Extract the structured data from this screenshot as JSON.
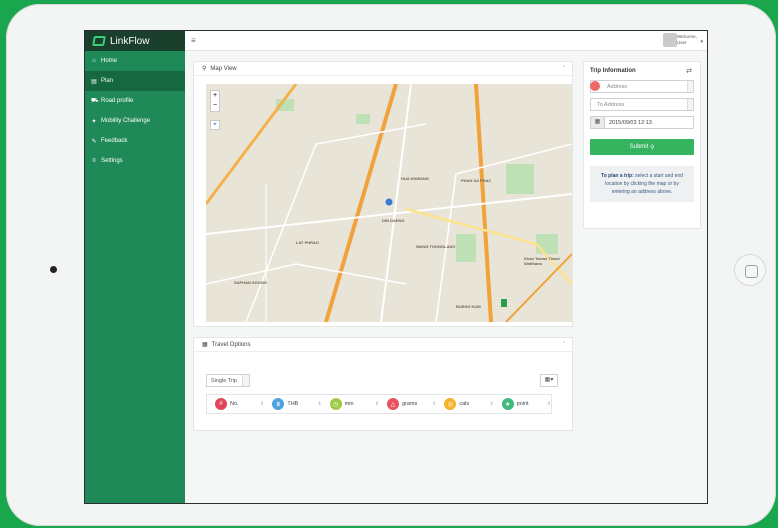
{
  "app": {
    "brand": "LinkFlow"
  },
  "sidebar": {
    "items": [
      {
        "label": "Home",
        "icon": "home-icon",
        "glyph": "⌂"
      },
      {
        "label": "Plan",
        "icon": "document-icon",
        "glyph": "▤"
      },
      {
        "label": "Road profile",
        "icon": "car-icon",
        "glyph": "⛟"
      },
      {
        "label": "Mobility Challenge",
        "icon": "trophy-icon",
        "glyph": "✦"
      },
      {
        "label": "Feedback",
        "icon": "chat-icon",
        "glyph": "✎"
      },
      {
        "label": "Settings",
        "icon": "list-icon",
        "glyph": "≡"
      }
    ]
  },
  "topbar": {
    "menu_glyph": "≡",
    "welcome": "Welcome,",
    "user": "User"
  },
  "map_panel": {
    "title": "Map View",
    "zoom_in": "+",
    "zoom_out": "−",
    "labels": [
      "PHAN XA PHAC",
      "HUA KHWANG",
      "DIN DAENG",
      "LAT PHRAO",
      "SAPHAN SOONG",
      "BUENG KUM",
      "Khan Tawan Thawi Watthana",
      "WANG THONGLANG"
    ]
  },
  "trip": {
    "title": "Trip Information",
    "from_placeholder": "Address",
    "to_placeholder": "To Address",
    "datetime": "2015/09/03 12:13",
    "submit": "Submit",
    "hint_bold": "To plan a trip:",
    "hint": "select a start and end location by clicking the map or by entering an address above."
  },
  "travel": {
    "title": "Travel Options",
    "trip_type": "Single Trip",
    "metrics": [
      {
        "label": "No.",
        "icon": "tag-icon",
        "color": "#e0455a",
        "glyph": "#"
      },
      {
        "label": "THB",
        "icon": "currency-icon",
        "color": "#4aa3df",
        "glyph": "฿"
      },
      {
        "label": "min",
        "icon": "clock-icon",
        "color": "#9ccc44",
        "glyph": "◷"
      },
      {
        "label": "grams",
        "icon": "co2-icon",
        "color": "#e7525d",
        "glyph": "△"
      },
      {
        "label": "cals",
        "icon": "calorie-icon",
        "color": "#f3b32a",
        "glyph": "◎"
      },
      {
        "label": "point",
        "icon": "point-icon",
        "color": "#3fb97c",
        "glyph": "★"
      }
    ]
  }
}
